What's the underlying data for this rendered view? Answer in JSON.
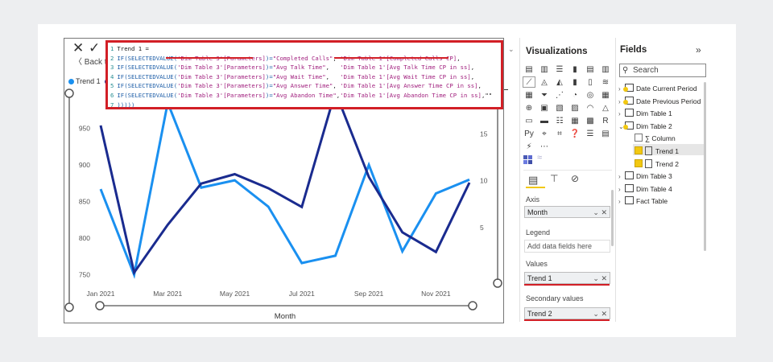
{
  "colors": {
    "series1": "#1a90f0",
    "series2": "#1a2b8f",
    "highlight": "#d21f26",
    "accent": "#f2c811"
  },
  "visual": {
    "close_icon": "✕",
    "confirm_icon": "✓",
    "back_label": "Back to",
    "legend": {
      "series1": "Trend 1",
      "series2": ""
    },
    "more_icon": "⌄"
  },
  "formula": {
    "lines": [
      {
        "n": "1",
        "parts": [
          {
            "t": "cl",
            "v": "Trend 1 ="
          }
        ]
      },
      {
        "n": "2",
        "parts": [
          {
            "t": "kw",
            "v": "IF(SELECTEDVALUE("
          },
          {
            "t": "st",
            "v": "'Dim Table 3'[Parameters]"
          },
          {
            "t": "kw",
            "v": ")="
          },
          {
            "t": "st",
            "v": "\"Completed Calls\""
          },
          {
            "t": "cl",
            "v": ", "
          },
          {
            "t": "st",
            "v": "'Dim Table 1'[Completed Calls CP]"
          },
          {
            "t": "cl",
            "v": ","
          }
        ]
      },
      {
        "n": "3",
        "parts": [
          {
            "t": "kw",
            "v": "IF(SELECTEDVALUE("
          },
          {
            "t": "st",
            "v": "'Dim Table 3'[Parameters]"
          },
          {
            "t": "kw",
            "v": ")="
          },
          {
            "t": "st",
            "v": "\"Avg Talk Time\""
          },
          {
            "t": "cl",
            "v": ",   "
          },
          {
            "t": "st",
            "v": "'Dim Table 1'[Avg Talk Time CP in ss]"
          },
          {
            "t": "cl",
            "v": ","
          }
        ]
      },
      {
        "n": "4",
        "parts": [
          {
            "t": "kw",
            "v": "IF(SELECTEDVALUE("
          },
          {
            "t": "st",
            "v": "'Dim Table 3'[Parameters]"
          },
          {
            "t": "kw",
            "v": ")="
          },
          {
            "t": "st",
            "v": "\"Avg Wait Time\""
          },
          {
            "t": "cl",
            "v": ",   "
          },
          {
            "t": "st",
            "v": "'Dim Table 1'[Avg Wait Time CP in ss]"
          },
          {
            "t": "cl",
            "v": ","
          }
        ]
      },
      {
        "n": "5",
        "parts": [
          {
            "t": "kw",
            "v": "IF(SELECTEDVALUE("
          },
          {
            "t": "st",
            "v": "'Dim Table 3'[Parameters]"
          },
          {
            "t": "kw",
            "v": ")="
          },
          {
            "t": "st",
            "v": "\"Avg Answer Time\""
          },
          {
            "t": "cl",
            "v": ", "
          },
          {
            "t": "st",
            "v": "'Dim Table 1'[Avg Answer Time CP in ss]"
          },
          {
            "t": "cl",
            "v": ","
          }
        ]
      },
      {
        "n": "6",
        "parts": [
          {
            "t": "kw",
            "v": "IF(SELECTEDVALUE("
          },
          {
            "t": "st",
            "v": "'Dim Table 3'[Parameters]"
          },
          {
            "t": "kw",
            "v": ")="
          },
          {
            "t": "st",
            "v": "\"Avg Abandon Time\""
          },
          {
            "t": "cl",
            "v": ","
          },
          {
            "t": "st",
            "v": "'Dim Table 1'[Avg Abandon Time CP in ss]"
          },
          {
            "t": "cl",
            "v": ",\"\""
          }
        ]
      },
      {
        "n": "7",
        "parts": [
          {
            "t": "kw",
            "v": ")))))"
          }
        ]
      }
    ]
  },
  "chart_data": {
    "type": "line",
    "xlabel": "Month",
    "categories": [
      "Jan 2021",
      "Feb 2021",
      "Mar 2021",
      "Apr 2021",
      "May 2021",
      "Jun 2021",
      "Jul 2021",
      "Aug 2021",
      "Sep 2021",
      "Oct 2021",
      "Nov 2021",
      "Dec 2021"
    ],
    "x_tick_labels": [
      "Jan 2021",
      "Mar 2021",
      "May 2021",
      "Jul 2021",
      "Sep 2021",
      "Nov 2021"
    ],
    "y_axis": {
      "ticks": [
        750,
        800,
        850,
        900,
        950
      ],
      "ylim": [
        744,
        1000
      ]
    },
    "y2_axis": {
      "ticks": [
        5,
        10,
        15
      ],
      "ylim": [
        -0.5,
        19.5
      ]
    },
    "series": [
      {
        "name": "Trend 1",
        "axis": "y",
        "values": [
          867,
          750,
          985,
          869,
          879,
          843,
          766,
          776,
          900,
          782,
          861,
          880
        ]
      },
      {
        "name": "",
        "axis": "y2",
        "values": [
          15.9,
          0.2,
          5.3,
          9.7,
          10.7,
          9.2,
          7.2,
          19.5,
          10.4,
          4.5,
          2.4,
          9.8
        ]
      }
    ],
    "grid": false
  },
  "viz_pane": {
    "title": "Visualizations",
    "icons": [
      "stacked-bar-icon",
      "stacked-column-icon",
      "clustered-bar-icon",
      "clustered-column-icon",
      "100-bar-icon",
      "100-column-icon",
      "line-chart-icon",
      "area-chart-icon",
      "stacked-area-icon",
      "line-column-icon",
      "line-clustered-icon",
      "ribbon-chart-icon",
      "waterfall-icon",
      "funnel-icon",
      "scatter-icon",
      "pie-icon",
      "donut-icon",
      "treemap-icon",
      "map-icon",
      "filled-map-icon",
      "shape-map-icon",
      "arcgis-icon",
      "gauge-icon",
      "kpi-icon",
      "card-icon",
      "multirow-card-icon",
      "slicer-icon",
      "table-icon",
      "matrix-icon",
      "r-visual-icon",
      "python-visual-icon",
      "key-influencers-icon",
      "decomposition-icon",
      "qa-icon",
      "narrative-icon",
      "paginated-icon",
      "power-apps-icon",
      "more-visuals-icon"
    ],
    "icon_glyphs": [
      "▤",
      "▥",
      "☰",
      "▮",
      "▤",
      "▥",
      "⟋",
      "◬",
      "◭",
      "▮",
      "▯",
      "≋",
      "▦",
      "⏷",
      "⋰",
      "◔",
      "◎",
      "▦",
      "⊕",
      "▣",
      "▧",
      "▨",
      "◠",
      "△",
      "▭",
      "▬",
      "☷",
      "▦",
      "▩",
      "R",
      "Py",
      "⌖",
      "⌗",
      "❓",
      "☰",
      "▤",
      "⚡",
      "⋯"
    ],
    "tabs": {
      "fields_icon": "▤",
      "format_icon": "🖌",
      "analytics_icon": "🔍"
    },
    "axis": {
      "header": "Axis",
      "value": "Month"
    },
    "legend": {
      "header": "Legend",
      "placeholder": "Add data fields here"
    },
    "values": {
      "header": "Values",
      "value": "Trend 1"
    },
    "secondary": {
      "header": "Secondary values",
      "value": "Trend 2"
    },
    "well_controls": "⌄ ✕"
  },
  "fields_pane": {
    "title": "Fields",
    "collapse_icon": "»",
    "search_placeholder": "Search",
    "items": [
      {
        "label": "Date Current Period",
        "level": 0,
        "chev": "›"
      },
      {
        "label": "Date Previous Period",
        "level": 0,
        "chev": "›"
      },
      {
        "label": "Dim Table 1",
        "level": 0,
        "chev": "›"
      },
      {
        "label": "Dim Table 2",
        "level": 0,
        "chev": "⌄"
      },
      {
        "label": "Column",
        "level": 1,
        "check": false,
        "sigma": "∑"
      },
      {
        "label": "Trend 1",
        "level": 1,
        "check": true
      },
      {
        "label": "Trend 2",
        "level": 1,
        "check": true
      },
      {
        "label": "Dim Table 3",
        "level": 0,
        "chev": "›"
      },
      {
        "label": "Dim Table 4",
        "level": 0,
        "chev": "›"
      },
      {
        "label": "Fact Table",
        "level": 0,
        "chev": "›"
      }
    ]
  }
}
